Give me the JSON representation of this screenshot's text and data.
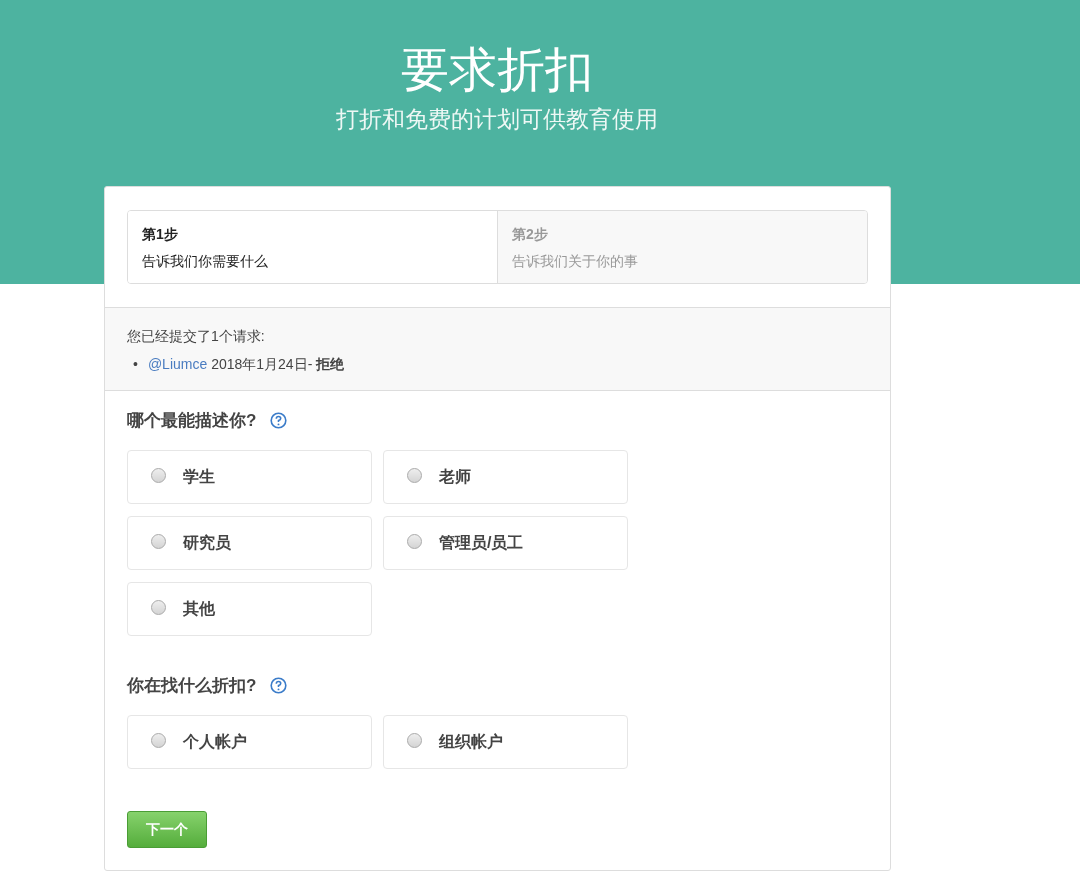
{
  "header": {
    "title": "要求折扣",
    "subtitle": "打折和免费的计划可供教育使用"
  },
  "steps": [
    {
      "label": "第1步",
      "description": "告诉我们你需要什么",
      "selected": true
    },
    {
      "label": "第2步",
      "description": "告诉我们关于你的事",
      "selected": false
    }
  ],
  "submitted": {
    "text": "您已经提交了1个请求:",
    "items": [
      {
        "marker": "•",
        "user": "@Liumce",
        "text": "2018年1月24日- **拒绝**"
      }
    ]
  },
  "questions": [
    {
      "title": "哪个最能描述你?",
      "options": [
        {
          "label": "学生",
          "selected": false
        },
        {
          "label": "老师",
          "selected": false
        },
        {
          "label": "研究员",
          "selected": false
        },
        {
          "label": "管理员/员工",
          "selected": false
        },
        {
          "label": "其他",
          "selected": false
        }
      ]
    },
    {
      "title": "你在找什么折扣?",
      "options": [
        {
          "label": "个人帐户",
          "selected": false
        },
        {
          "label": "组织帐户",
          "selected": false
        }
      ]
    }
  ],
  "next_button": "下一个"
}
